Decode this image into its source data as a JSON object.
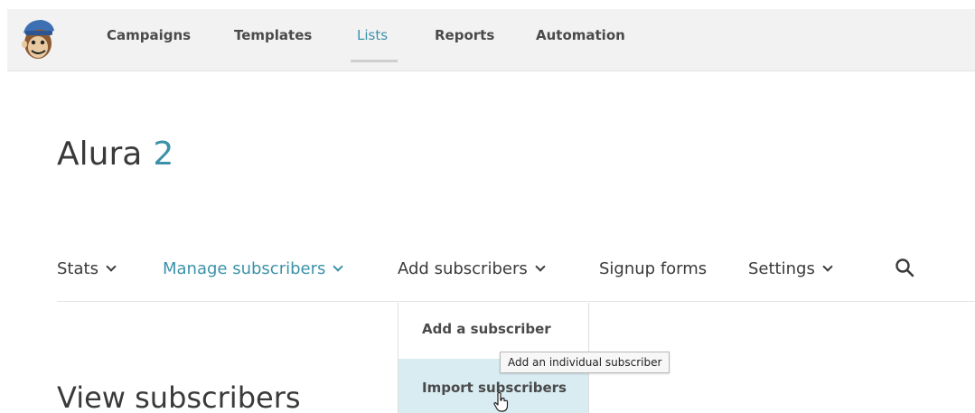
{
  "topnav": {
    "items": [
      {
        "label": "Campaigns",
        "active": false
      },
      {
        "label": "Templates",
        "active": false
      },
      {
        "label": "Lists",
        "active": true
      },
      {
        "label": "Reports",
        "active": false
      },
      {
        "label": "Automation",
        "active": false
      }
    ],
    "logo_icon": "chimp-logo-icon"
  },
  "list": {
    "name": "Alura",
    "count": "2"
  },
  "subnav": {
    "items": [
      {
        "label": "Stats",
        "has_dropdown": true,
        "active": false
      },
      {
        "label": "Manage subscribers",
        "has_dropdown": true,
        "active": true
      },
      {
        "label": "Add subscribers",
        "has_dropdown": true,
        "active": false
      },
      {
        "label": "Signup forms",
        "has_dropdown": false,
        "active": false
      },
      {
        "label": "Settings",
        "has_dropdown": true,
        "active": false
      }
    ],
    "search_icon": "search-icon"
  },
  "dropdown": {
    "items": [
      {
        "label": "Add a subscriber",
        "highlighted": false
      },
      {
        "label": "Import subscribers",
        "highlighted": true
      }
    ]
  },
  "tooltip": {
    "text": "Add an individual subscriber"
  },
  "main": {
    "section_heading": "View subscribers"
  },
  "colors": {
    "accent": "#3b92a8",
    "nav_background": "#f2f2f2",
    "highlight": "#d8ecf2"
  }
}
